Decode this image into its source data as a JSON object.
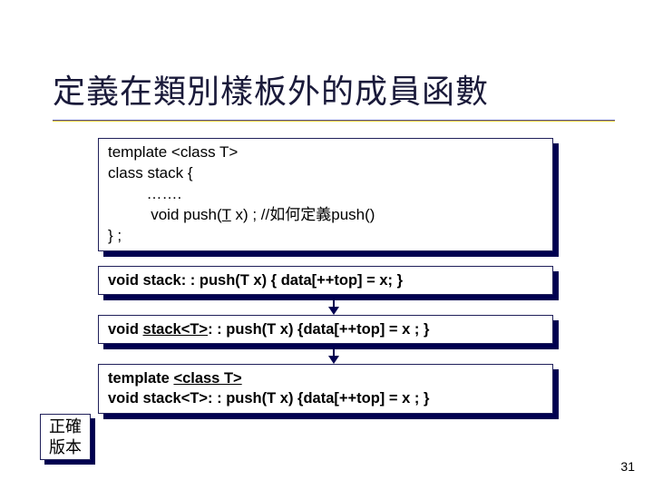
{
  "title": "定義在類別樣板外的成員函數",
  "code1": {
    "l1": "template <class T>",
    "l2": "class stack {",
    "l3": "         …….",
    "l4a": "          void push(",
    "l4u": "T",
    "l4b": " x) ; //如何定義push()",
    "l5": "} ;"
  },
  "code2": "void stack: : push(T x) { data[++top] = x; }",
  "code3": {
    "a": "void ",
    "u": "stack<T>",
    "b": ": : push(T x) {data[++top] = x ; }"
  },
  "code4": {
    "l1a": "template ",
    "l1u": "<class T>",
    "l2": "void stack<T>: : push(T x) {data[++top] = x ; }"
  },
  "label": {
    "line1": "正確",
    "line2": "版本"
  },
  "page_number": "31"
}
